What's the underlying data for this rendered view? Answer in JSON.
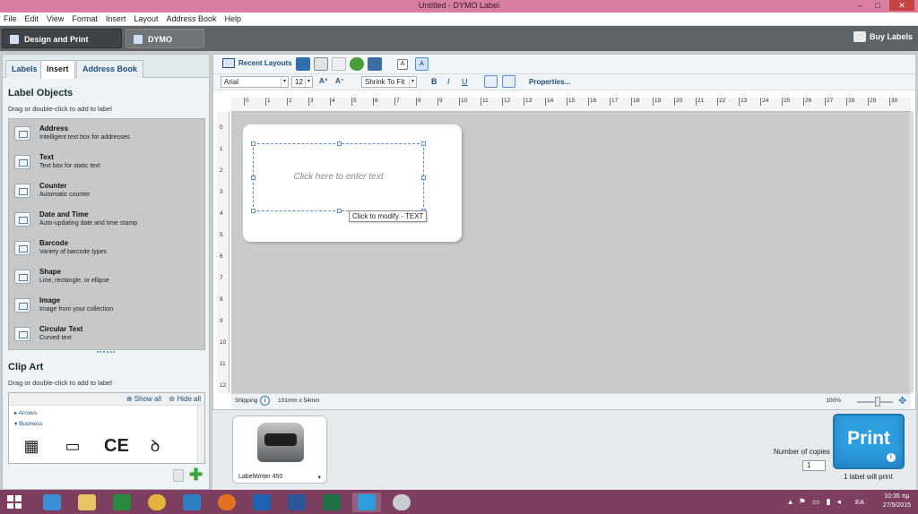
{
  "window": {
    "title": "Untitled - DYMO Label"
  },
  "menu": [
    "File",
    "Edit",
    "View",
    "Format",
    "Insert",
    "Layout",
    "Address Book",
    "Help"
  ],
  "apptoolbar": {
    "design_print": "Design and Print Labels",
    "dymo_online": "DYMO Online",
    "buy_labels": "Buy Labels"
  },
  "leftpanel": {
    "tabs": [
      "Labels",
      "Insert",
      "Address Book"
    ],
    "label_objects_title": "Label Objects",
    "label_objects_hint": "Drag or double-click to add to label",
    "objects": [
      {
        "name": "Address",
        "desc": "Intelligent text box for addresses"
      },
      {
        "name": "Text",
        "desc": "Text box for static text"
      },
      {
        "name": "Counter",
        "desc": "Automatic counter"
      },
      {
        "name": "Date and Time",
        "desc": "Auto-updating date and time stamp"
      },
      {
        "name": "Barcode",
        "desc": "Variety of barcode types"
      },
      {
        "name": "Shape",
        "desc": "Line, rectangle, or ellipse"
      },
      {
        "name": "Image",
        "desc": "Image from your collection"
      },
      {
        "name": "Circular Text",
        "desc": "Curved text"
      }
    ],
    "clipart_title": "Clip Art",
    "clipart_hint": "Drag or double-click to add to label",
    "show_all": "Show all",
    "hide_all": "Hide all",
    "categories": [
      "Arrows",
      "Business"
    ]
  },
  "editor": {
    "recent_layouts": "Recent Layouts",
    "font": "Arial",
    "size": "12",
    "fit": "Shrink To Fit",
    "bold": "B",
    "italic": "I",
    "underline": "U",
    "properties": "Properties...",
    "ruler_h": [
      "0",
      "1",
      "2",
      "3",
      "4",
      "5",
      "6",
      "7",
      "8",
      "9",
      "10",
      "11",
      "12",
      "13",
      "14",
      "15",
      "16",
      "17",
      "18",
      "19",
      "20",
      "21",
      "22",
      "23",
      "24",
      "25",
      "26",
      "27",
      "28",
      "29",
      "30"
    ],
    "ruler_v": [
      "0",
      "1",
      "2",
      "3",
      "4",
      "5",
      "6",
      "7",
      "8",
      "9",
      "10",
      "11",
      "12"
    ],
    "placeholder": "Click here to enter text",
    "tooltip": "Click to modify - TEXT",
    "status_label": "Shipping",
    "status_size": "101mm x 54mm",
    "zoom": "100%"
  },
  "bottom": {
    "printer_name": "LabelWriter 450",
    "copies_label": "Number of copies",
    "copies_value": "1",
    "print": "Print",
    "will_print": "1 label will print"
  },
  "taskbar": {
    "lang": "EA",
    "time": "10:35 πμ",
    "date": "27/5/2015"
  }
}
